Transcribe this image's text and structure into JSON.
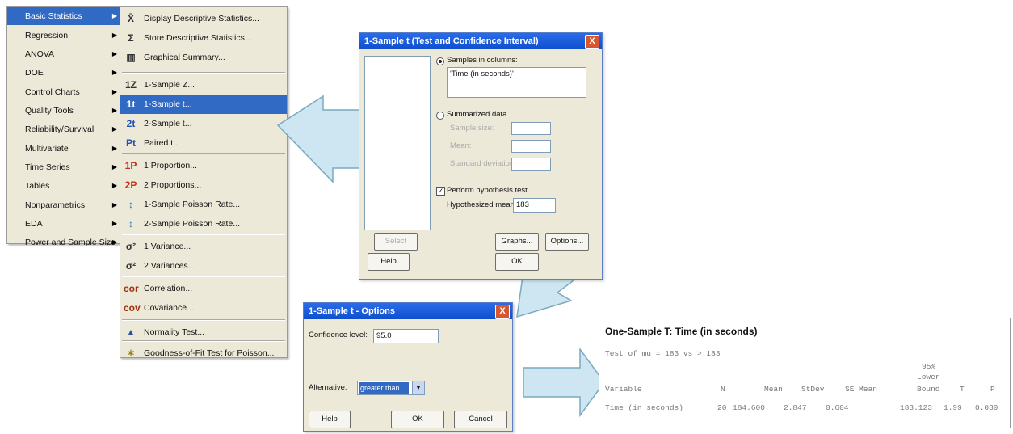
{
  "left_menu": {
    "items": [
      {
        "label": "Basic Statistics",
        "has_submenu": true,
        "active": true
      },
      {
        "label": "Regression",
        "has_submenu": true
      },
      {
        "label": "ANOVA",
        "has_submenu": true
      },
      {
        "label": "DOE",
        "has_submenu": true
      },
      {
        "label": "Control Charts",
        "has_submenu": true
      },
      {
        "label": "Quality Tools",
        "has_submenu": true
      },
      {
        "label": "Reliability/Survival",
        "has_submenu": true
      },
      {
        "label": "Multivariate",
        "has_submenu": true
      },
      {
        "label": "Time Series",
        "has_submenu": true
      },
      {
        "label": "Tables",
        "has_submenu": true
      },
      {
        "label": "Nonparametrics",
        "has_submenu": true
      },
      {
        "label": "EDA",
        "has_submenu": true
      },
      {
        "label": "Power and Sample Size",
        "has_submenu": true
      }
    ]
  },
  "sub_menu": {
    "items": [
      {
        "icon": "X̄",
        "label": "Display Descriptive Statistics..."
      },
      {
        "icon": "Σ",
        "label": "Store Descriptive Statistics..."
      },
      {
        "icon": "▥",
        "label": "Graphical Summary..."
      },
      {
        "icon": "1Z",
        "label": "1-Sample Z..."
      },
      {
        "icon": "1t",
        "label": "1-Sample t...",
        "active": true
      },
      {
        "icon": "2t",
        "label": "2-Sample t..."
      },
      {
        "icon": "Pt",
        "label": "Paired t..."
      },
      {
        "icon": "1P",
        "label": "1 Proportion..."
      },
      {
        "icon": "2P",
        "label": "2 Proportions..."
      },
      {
        "icon": "↕",
        "label": "1-Sample Poisson Rate..."
      },
      {
        "icon": "↕",
        "label": "2-Sample Poisson Rate..."
      },
      {
        "icon": "σ²",
        "label": "1 Variance..."
      },
      {
        "icon": "σ²",
        "label": "2 Variances..."
      },
      {
        "icon": "cor",
        "label": "Correlation..."
      },
      {
        "icon": "cov",
        "label": "Covariance..."
      },
      {
        "icon": "▲",
        "label": "Normality Test..."
      },
      {
        "icon": "✶",
        "label": "Goodness-of-Fit Test for Poisson..."
      }
    ]
  },
  "main_dialog": {
    "title": "1-Sample t (Test and Confidence Interval)",
    "close": "X",
    "samples_in_columns": "Samples in columns:",
    "columns_value": "'Time (in seconds)'",
    "summarized_data": "Summarized data",
    "sample_size": "Sample size:",
    "mean": "Mean:",
    "std_dev": "Standard deviation:",
    "perform_test": "Perform hypothesis test",
    "hyp_mean_label": "Hypothesized mean:",
    "hyp_mean_value": "183",
    "select_btn": "Select",
    "graphs_btn": "Graphs...",
    "options_btn": "Options...",
    "help_btn": "Help",
    "ok_btn": "OK"
  },
  "options_dialog": {
    "title": "1-Sample t - Options",
    "close": "X",
    "conf_label": "Confidence level:",
    "conf_value": "95.0",
    "alt_label": "Alternative:",
    "alt_value": "greater than",
    "help_btn": "Help",
    "ok_btn": "OK",
    "cancel_btn": "Cancel"
  },
  "output": {
    "title": "One-Sample T: Time (in seconds)",
    "test_line": "Test of mu = 183 vs > 183",
    "header_top": "95%",
    "header_mid": "Lower",
    "header_cols": [
      "Variable",
      "N",
      "Mean",
      "StDev",
      "SE Mean",
      "Bound",
      "T",
      "P"
    ],
    "row": [
      "Time (in seconds)",
      "20",
      "184.600",
      "2.847",
      "0.604",
      "183.123",
      "1.99",
      "0.039"
    ]
  },
  "colors": {
    "highlight": "#316ac5",
    "arrow_fill": "#cde6f2",
    "arrow_stroke": "#7aa9c2",
    "circle": "#e04040"
  }
}
